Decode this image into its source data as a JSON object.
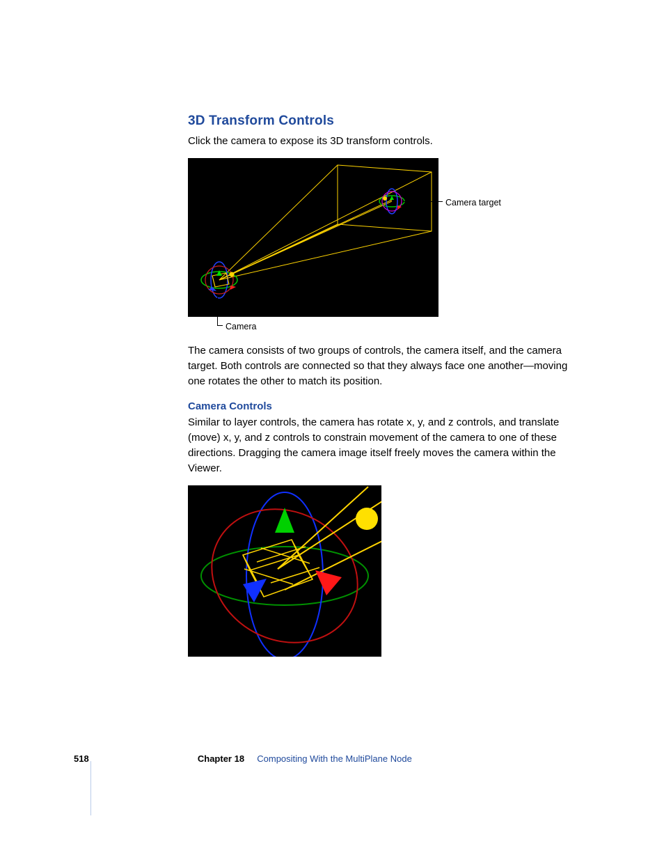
{
  "section_heading": "3D Transform Controls",
  "intro_text": "Click the camera to expose its 3D transform controls.",
  "fig1_labels": {
    "target": "Camera target",
    "camera": "Camera"
  },
  "after_fig1": "The camera consists of two groups of controls, the camera itself, and the camera target. Both controls are connected so that they always face one another—moving one rotates the other to match its position.",
  "sub_heading": "Camera Controls",
  "sub_text": "Similar to layer controls, the camera has rotate x, y, and z controls, and translate (move) x, y, and z controls to constrain movement of the camera to one of these directions. Dragging the camera image itself freely moves the camera within the Viewer.",
  "footer": {
    "page": "518",
    "chapter": "Chapter 18",
    "title": "Compositing With the MultiPlane Node"
  }
}
